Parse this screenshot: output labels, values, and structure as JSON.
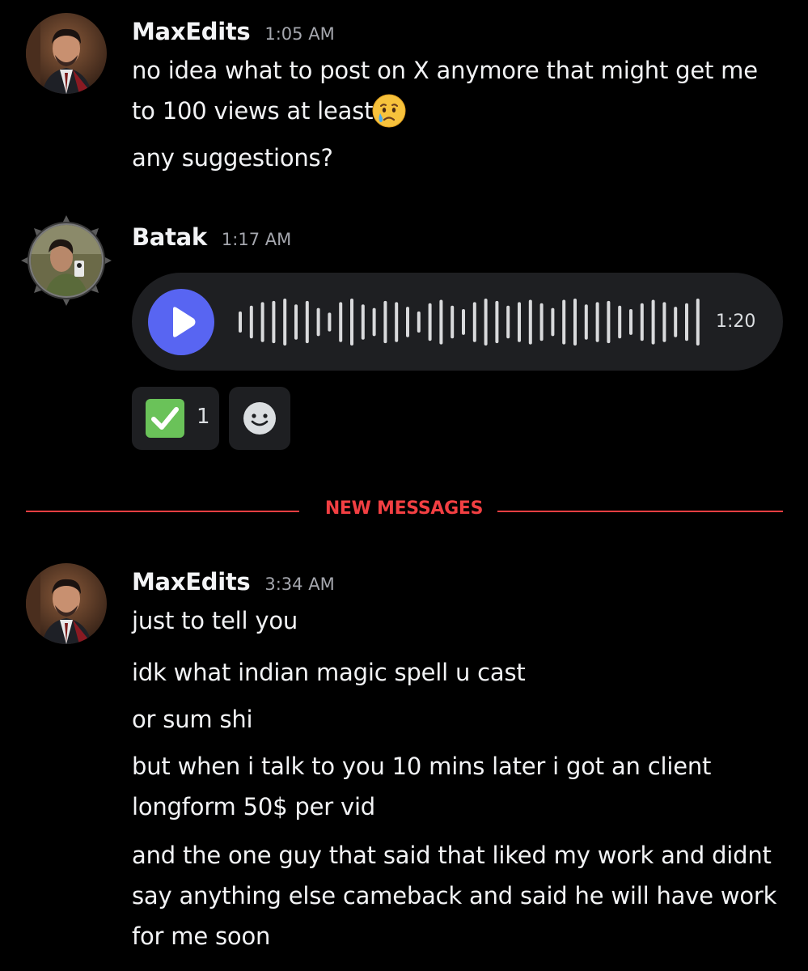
{
  "messages": [
    {
      "username": "MaxEdits",
      "timestamp": "1:05 AM",
      "lines": [
        "no idea what to post on X anymore that might get me",
        "to 100 views at least",
        "any suggestions?"
      ],
      "emoji": "crying-face-emoji"
    },
    {
      "username": "Batak",
      "timestamp": "1:17 AM",
      "voice_message": {
        "duration": "1:20"
      },
      "reactions": [
        {
          "emoji": "white-check-mark-emoji",
          "count": "1"
        },
        {
          "emoji": "add-reaction-icon"
        }
      ]
    }
  ],
  "divider": {
    "label": "NEW MESSAGES"
  },
  "latest": {
    "username": "MaxEdits",
    "timestamp": "3:34 AM",
    "lines": [
      "just to tell you",
      "idk what indian magic spell u cast",
      "or sum shi",
      "but when i talk to you 10 mins later i got an client",
      "longform 50$ per vid",
      "and the one guy that said that liked my work and didnt",
      "say anything else cameback and said he will have work",
      "for me soon"
    ]
  },
  "colors": {
    "background": "#000000",
    "accent": "#5865f2",
    "divider": "#f23f42",
    "surface": "#1e1f22"
  }
}
